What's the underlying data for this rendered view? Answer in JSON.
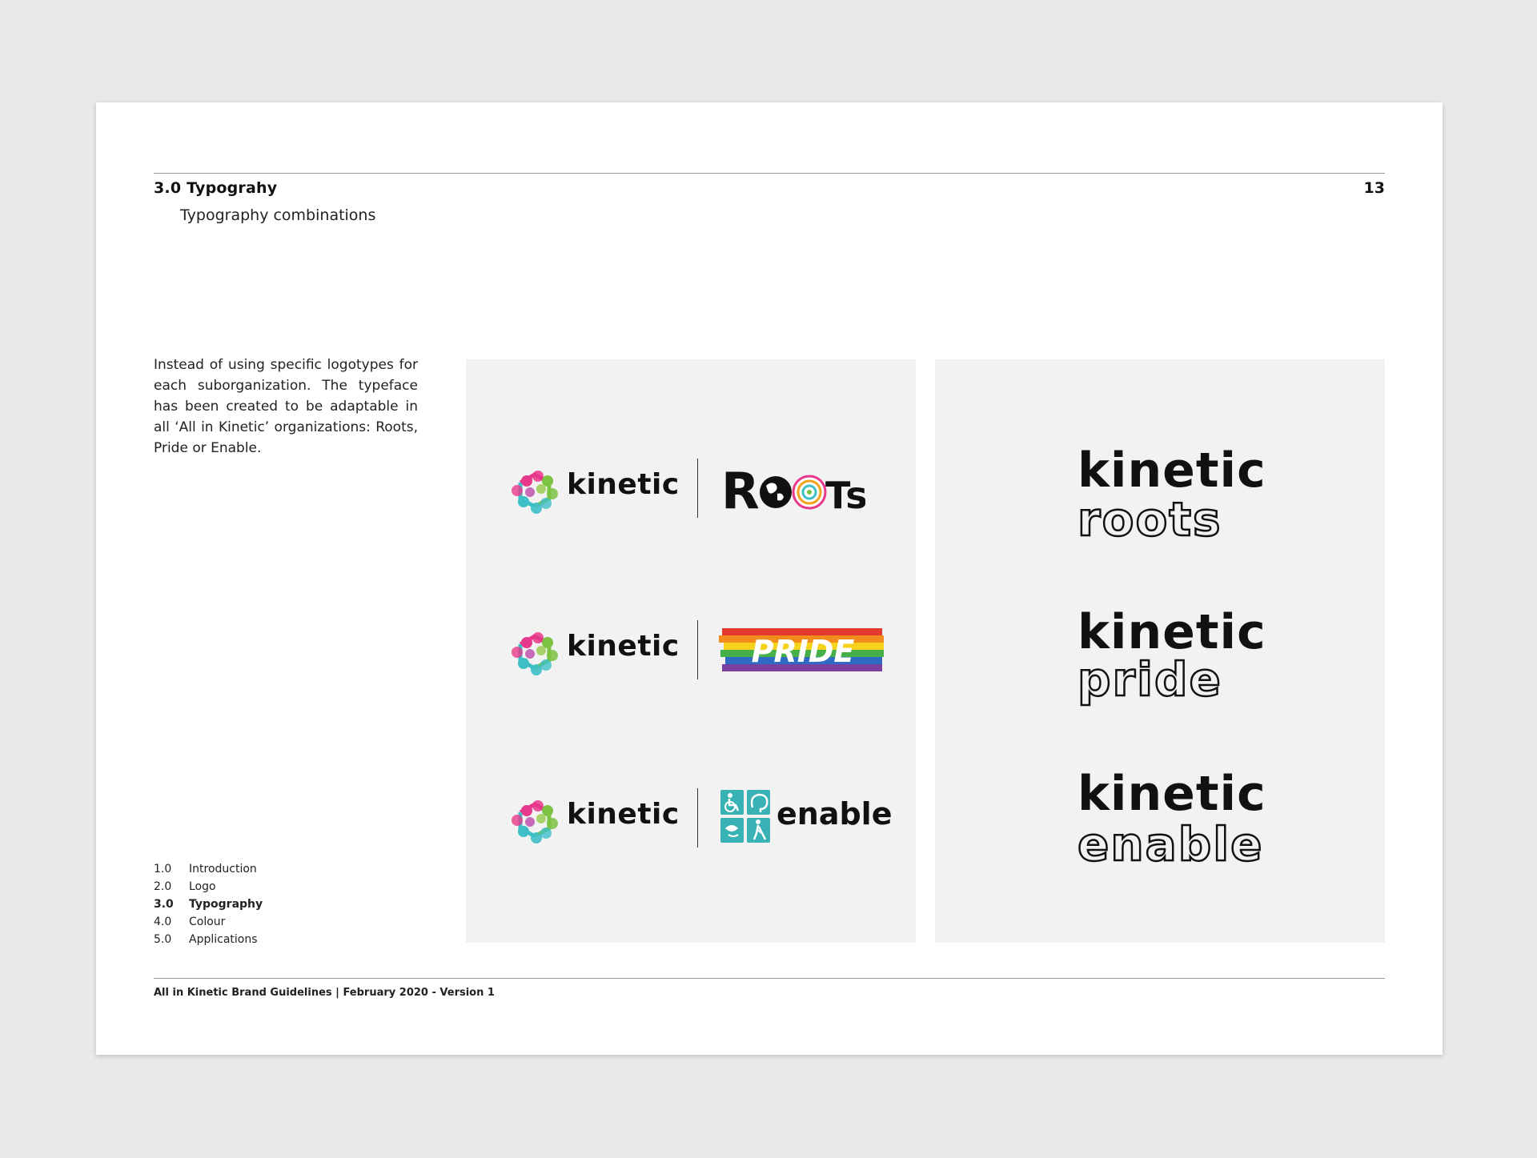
{
  "header": {
    "section_title": "3.0 Typograhy",
    "subtitle": "Typography combinations",
    "page_number": "13"
  },
  "intro": "Instead of using specific logotypes for each suborganization. The typeface has been created to be adaptable in all ‘All in Kinetic’ organizations: Roots, Pride or Enable.",
  "toc": [
    {
      "num": "1.0",
      "label": "Introduction",
      "active": false
    },
    {
      "num": "2.0",
      "label": "Logo",
      "active": false
    },
    {
      "num": "3.0",
      "label": "Typography",
      "active": true
    },
    {
      "num": "4.0",
      "label": "Colour",
      "active": false
    },
    {
      "num": "5.0",
      "label": "Applications",
      "active": false
    }
  ],
  "footer": "All in Kinetic Brand Guidelines  |  February 2020 - Version 1",
  "combos": {
    "brand": "kinetic",
    "roots": "Roots",
    "pride": "PRIDE",
    "enable": "enable"
  },
  "stacks": {
    "brand": "kinetic",
    "roots": "roots",
    "pride": "pride",
    "enable": "enable"
  },
  "colors": {
    "magenta": "#e8388b",
    "green": "#7cc243",
    "teal": "#3ebfc8",
    "enable_teal": "#38b2b4"
  }
}
